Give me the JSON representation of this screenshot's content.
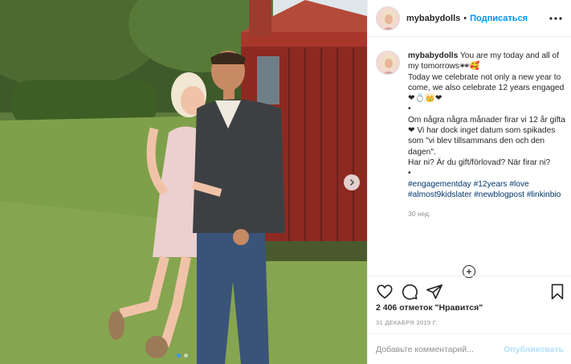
{
  "post": {
    "username": "mybabydolls",
    "separator": "•",
    "follow_label": "Подписаться",
    "more_icon": "more-horizontal-icon"
  },
  "caption": {
    "username": "mybabydolls",
    "lines": [
      "You are my today and all of my tomorrows🕶🥰",
      "Today we celebrate not only a new year to come, we also celebrate 12 years engaged ❤💍👑❤",
      "•",
      "Om några några månader firar vi 12 år gifta❤ Vi har dock inget datum som spikades som \"vi blev tillsammans den och den dagen\".",
      "Har ni? Är du gift/förlovad? När firar ni?",
      "•"
    ],
    "hashtags": [
      "#engagementday",
      "#12years",
      "#love",
      "#almost9kidslater",
      "#newblogpost",
      "#linkinbio"
    ],
    "time_ago": "30 нед."
  },
  "actions": {
    "like_icon": "heart-icon",
    "comment_icon": "comment-icon",
    "share_icon": "send-icon",
    "save_icon": "bookmark-icon"
  },
  "likes_text": "2 406 отметок \"Нравится\"",
  "date_text": "31 ДЕКАБРЯ 2019 Г.",
  "comment": {
    "placeholder": "Добавьте комментарий...",
    "post_label": "Опубликовать"
  },
  "carousel": {
    "slides": 2,
    "current": 1,
    "next_icon": "chevron-right-icon"
  },
  "colors": {
    "accent": "#0095f6",
    "post_disabled": "#b2dffc",
    "link": "#00376b",
    "muted": "#8e8e8e"
  }
}
